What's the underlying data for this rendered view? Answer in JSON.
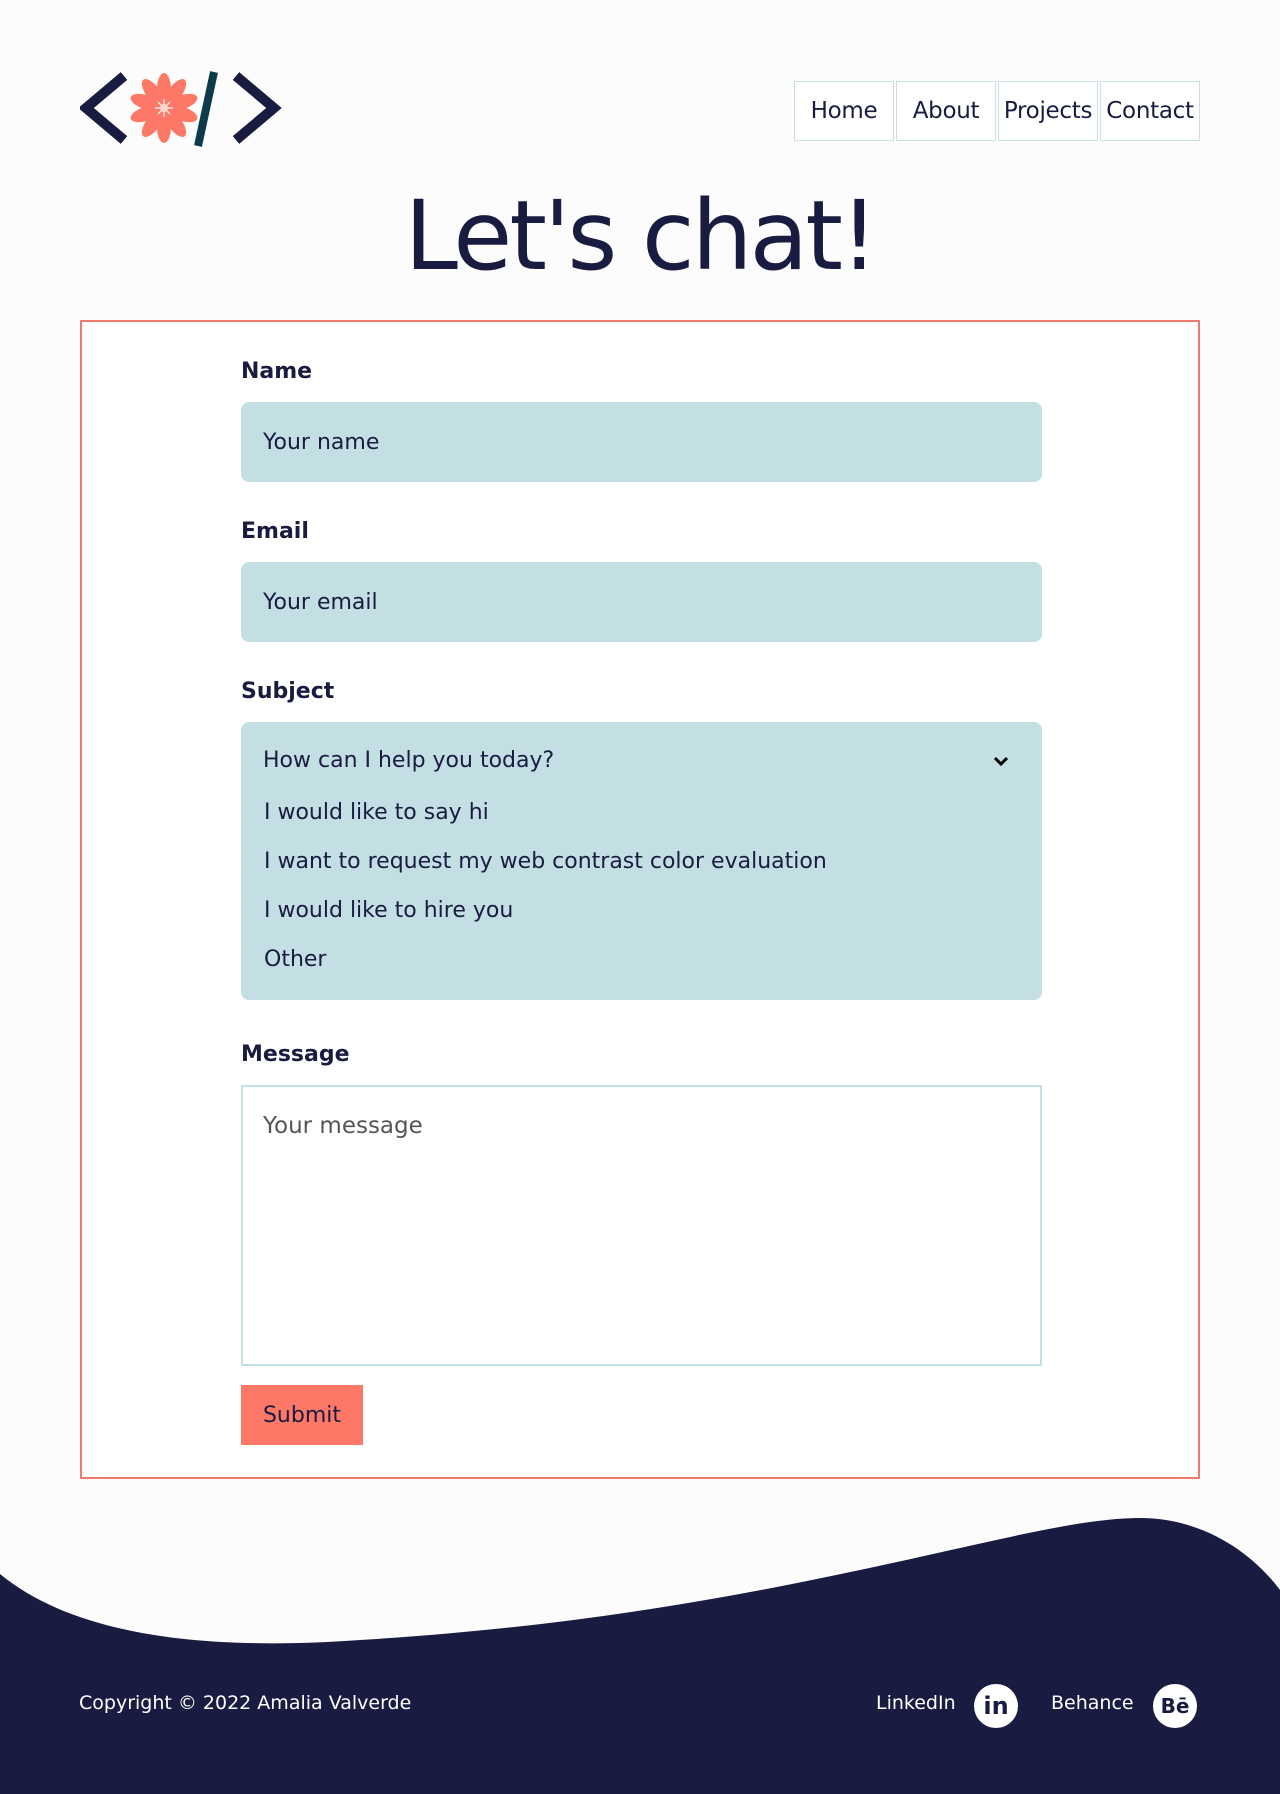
{
  "nav": {
    "items": [
      "Home",
      "About",
      "Projects",
      "Contact"
    ]
  },
  "page_title": "Let's chat!",
  "form": {
    "name": {
      "label": "Name",
      "placeholder": "Your name"
    },
    "email": {
      "label": "Email",
      "placeholder": "Your email"
    },
    "subject": {
      "label": "Subject",
      "selected": "How can I help you today?",
      "options": [
        "I would like to say hi",
        "I want to request my web contrast color evaluation",
        "I would like to hire you",
        "Other"
      ]
    },
    "message": {
      "label": "Message",
      "placeholder": "Your message"
    },
    "submit_label": "Submit"
  },
  "footer": {
    "copyright": "Copyright © 2022 Amalia Valverde",
    "links": [
      {
        "label": "LinkedIn",
        "icon": "linkedin-icon",
        "icon_text": "in"
      },
      {
        "label": "Behance",
        "icon": "behance-icon",
        "icon_text": "Bē"
      }
    ]
  },
  "colors": {
    "navy": "#191b40",
    "coral": "#fe7868",
    "field_blue": "#c3dfe3",
    "border_red": "#ee7a70"
  }
}
